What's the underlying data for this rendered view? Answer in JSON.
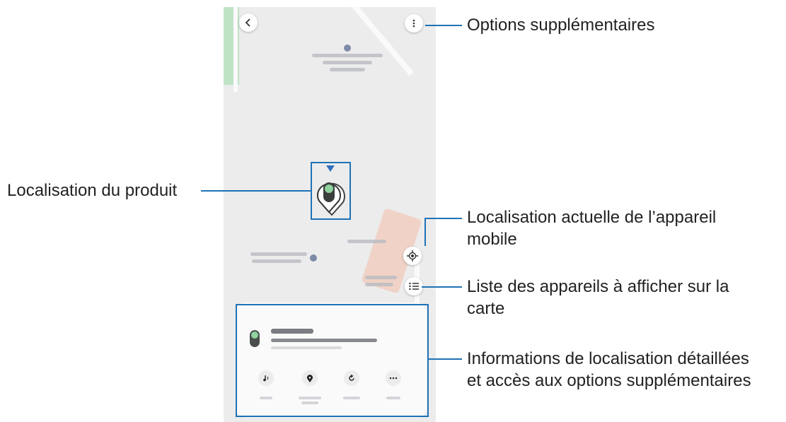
{
  "annotations": {
    "options": "Options supplémentaires",
    "product_location": "Localisation du produit",
    "current_location_line1": "Localisation actuelle de l’appareil",
    "current_location_line2": "mobile",
    "device_list_line1": "Liste des appareils à afficher sur la",
    "device_list_line2": "carte",
    "details_line1": "Informations de localisation détaillées",
    "details_line2": "et accès aux options supplémentaires"
  },
  "icons": {
    "back": "chevron-left-icon",
    "more": "more-vertical-icon",
    "my_location": "crosshair-icon",
    "list": "list-icon",
    "ring": "music-note-icon",
    "location_history": "map-pin-icon",
    "refresh": "refresh-icon",
    "more_actions": "more-horizontal-icon"
  },
  "colors": {
    "callout": "#1f72b7",
    "map_background": "#ececec",
    "tag_green": "#3fae5a"
  }
}
